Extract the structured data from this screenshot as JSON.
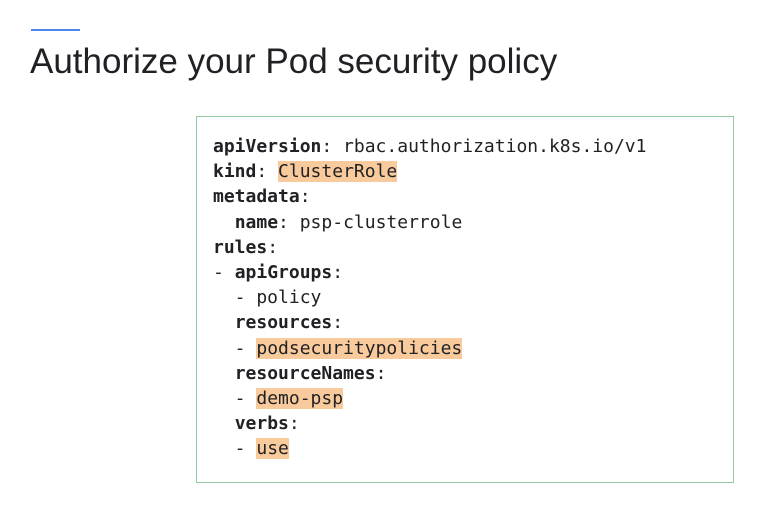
{
  "slide": {
    "title": "Authorize your Pod security policy",
    "accent_color": "#4a86e8",
    "box_border_color": "#93c9a3",
    "highlight_color": "#f9cb9c"
  },
  "code": {
    "lines": [
      {
        "segments": [
          {
            "text": "apiVersion",
            "style": "key"
          },
          {
            "text": ": rbac.authorization.k8s.io/v1",
            "style": "plain"
          }
        ]
      },
      {
        "segments": [
          {
            "text": "kind",
            "style": "key"
          },
          {
            "text": ": ",
            "style": "plain"
          },
          {
            "text": "ClusterRole",
            "style": "highlight"
          }
        ]
      },
      {
        "segments": [
          {
            "text": "metadata",
            "style": "key"
          },
          {
            "text": ":",
            "style": "plain"
          }
        ]
      },
      {
        "segments": [
          {
            "text": "  ",
            "style": "plain"
          },
          {
            "text": "name",
            "style": "key"
          },
          {
            "text": ": psp-clusterrole",
            "style": "plain"
          }
        ]
      },
      {
        "segments": [
          {
            "text": "rules",
            "style": "key"
          },
          {
            "text": ":",
            "style": "plain"
          }
        ]
      },
      {
        "segments": [
          {
            "text": "- ",
            "style": "plain"
          },
          {
            "text": "apiGroups",
            "style": "key"
          },
          {
            "text": ":",
            "style": "plain"
          }
        ]
      },
      {
        "segments": [
          {
            "text": "  - policy",
            "style": "plain"
          }
        ]
      },
      {
        "segments": [
          {
            "text": "  ",
            "style": "plain"
          },
          {
            "text": "resources",
            "style": "key"
          },
          {
            "text": ":",
            "style": "plain"
          }
        ]
      },
      {
        "segments": [
          {
            "text": "  - ",
            "style": "plain"
          },
          {
            "text": "podsecuritypolicies",
            "style": "highlight"
          }
        ]
      },
      {
        "segments": [
          {
            "text": "  ",
            "style": "plain"
          },
          {
            "text": "resourceNames",
            "style": "key"
          },
          {
            "text": ":",
            "style": "plain"
          }
        ]
      },
      {
        "segments": [
          {
            "text": "  - ",
            "style": "plain"
          },
          {
            "text": "demo-psp",
            "style": "highlight"
          }
        ]
      },
      {
        "segments": [
          {
            "text": "  ",
            "style": "plain"
          },
          {
            "text": "verbs",
            "style": "key"
          },
          {
            "text": ":",
            "style": "plain"
          }
        ]
      },
      {
        "segments": [
          {
            "text": "  - ",
            "style": "plain"
          },
          {
            "text": "use",
            "style": "highlight"
          }
        ]
      }
    ]
  }
}
